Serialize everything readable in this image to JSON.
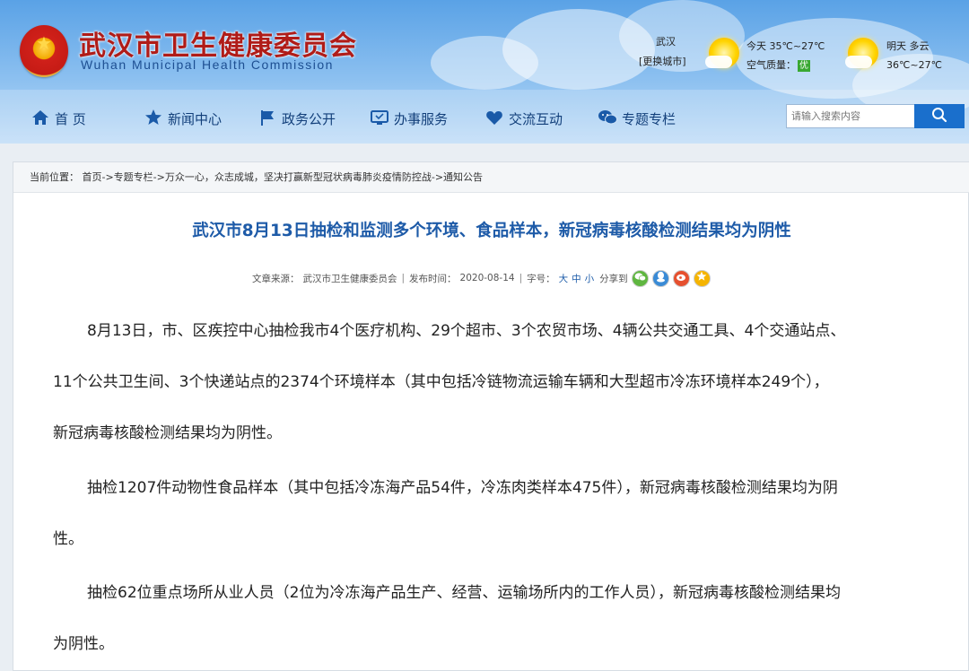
{
  "header": {
    "title_cn": "武汉市卫生健康委员会",
    "title_en": "Wuhan Municipal Health Commission"
  },
  "weather": {
    "city": "武汉",
    "change_city": "[更换城市]",
    "today_label": "今天 35℃~27℃",
    "air_quality_label": "空气质量：",
    "air_quality_value": "优",
    "tomorrow_label": "明天 多云",
    "tomorrow_temp": "36℃~27℃"
  },
  "nav": {
    "items": [
      {
        "label": "首 页",
        "icon": "home-icon"
      },
      {
        "label": "新闻中心",
        "icon": "star-icon"
      },
      {
        "label": "政务公开",
        "icon": "flag-icon"
      },
      {
        "label": "办事服务",
        "icon": "monitor-icon"
      },
      {
        "label": "交流互动",
        "icon": "heart-icon"
      },
      {
        "label": "专题专栏",
        "icon": "chat-icon"
      }
    ]
  },
  "search": {
    "placeholder": "请输入搜索内容"
  },
  "breadcrumb": {
    "text": "当前位置： 首页->专题专栏->万众一心，众志成城，坚决打赢新型冠状病毒肺炎疫情防控战->通知公告"
  },
  "article": {
    "title": "武汉市8月13日抽检和监测多个环境、食品样本，新冠病毒核酸检测结果均为阴性",
    "source_label": "文章来源：",
    "source_value": "武汉市卫生健康委员会",
    "date_label": "发布时间：",
    "date_value": "2020-08-14",
    "font_label": "字号：",
    "font_large": "大",
    "font_medium": "中",
    "font_small": "小",
    "share_label": "分享到",
    "paragraphs": {
      "p1_line1": "8月13日，市、区疾控中心抽检我市4个医疗机构、29个超市、3个农贸市场、4辆公共交通工具、4个交通站点、",
      "p1_line2": "11个公共卫生间、3个快递站点的2374个环境样本（其中包括冷链物流运输车辆和大型超市冷冻环境样本249个），",
      "p1_line3": "新冠病毒核酸检测结果均为阴性。",
      "p2_line1": "抽检1207件动物性食品样本（其中包括冷冻海产品54件，冷冻肉类样本475件），新冠病毒核酸检测结果均为阴",
      "p2_line2": "性。",
      "p3_line1": "抽检62位重点场所从业人员（2位为冷冻海产品生产、经营、运输场所内的工作人员），新冠病毒核酸检测结果均",
      "p3_line2": "为阴性。"
    }
  }
}
